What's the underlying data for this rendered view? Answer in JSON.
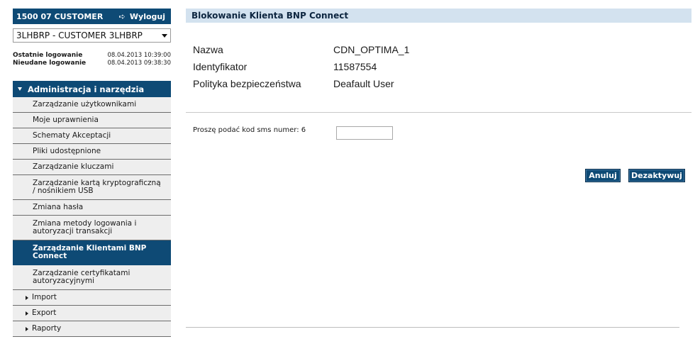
{
  "customer": {
    "header": "1500 07 CUSTOMER",
    "logout_label": "Wyloguj",
    "logout_icon": "logout-arrow-icon",
    "selected": "3LHBRP - CUSTOMER 3LHBRP"
  },
  "login_info": {
    "last_label": "Ostatnie logowanie",
    "last_value": "08.04.2013 10:39:00",
    "failed_label": "Nieudane logowanie",
    "failed_value": "08.04.2013 09:38:30"
  },
  "menu": {
    "section_title": "Administracja i narzędzia",
    "items": [
      {
        "label": "Zarządzanie użytkownikami"
      },
      {
        "label": "Moje uprawnienia"
      },
      {
        "label": "Schematy Akceptacji"
      },
      {
        "label": "Pliki udostępnione"
      },
      {
        "label": "Zarządzanie kluczami"
      },
      {
        "label": "Zarządzanie kartą kryptograficzną / nośnikiem USB"
      },
      {
        "label": "Zmiana hasła"
      },
      {
        "label": "Zmiana metody logowania i autoryzacji transakcji"
      },
      {
        "label": "Zarządzanie Klientami BNP Connect"
      },
      {
        "label": "Zarządzanie certyfikatami autoryzacyjnymi"
      }
    ],
    "groups": [
      {
        "label": "Import"
      },
      {
        "label": "Export"
      },
      {
        "label": "Raporty"
      }
    ]
  },
  "main": {
    "title": "Blokowanie Klienta BNP Connect",
    "fields": [
      {
        "label": "Nazwa",
        "value": "CDN_OPTIMA_1"
      },
      {
        "label": "Identyfikator",
        "value": "11587554"
      },
      {
        "label": "Polityka bezpieczeństwa",
        "value": "Deafault User"
      }
    ],
    "sms_label": "Proszę podać kod sms numer: 6",
    "sms_value": "",
    "cancel_label": "Anuluj",
    "deactivate_label": "Dezaktywuj"
  },
  "colors": {
    "accent": "#0e4a75",
    "title_bar": "#d3e2ef",
    "menu_bg": "#eeeeee"
  }
}
